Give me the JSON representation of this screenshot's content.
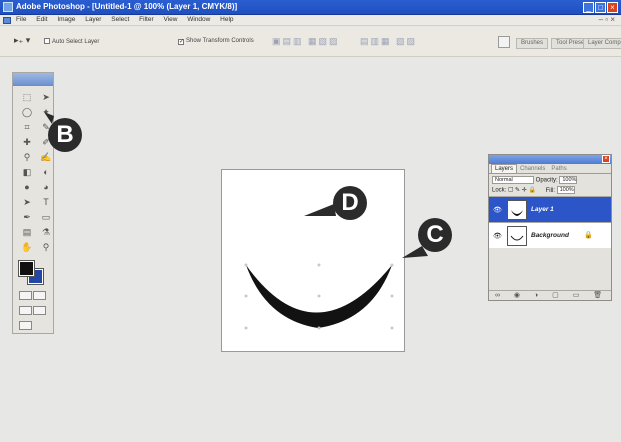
{
  "window": {
    "title": "Adobe Photoshop - [Untitled-1 @ 100% (Layer 1, CMYK/8)]",
    "controls": [
      "_",
      "□",
      "×"
    ]
  },
  "menu": {
    "items": [
      "File",
      "Edit",
      "Image",
      "Layer",
      "Select",
      "Filter",
      "View",
      "Window",
      "Help"
    ]
  },
  "options_bar": {
    "auto_select_layer": "Auto Select Layer",
    "show_transform_controls": "Show Transform Controls",
    "palette_tabs": [
      "Brushes",
      "Tool Presets",
      "Layer Comps"
    ]
  },
  "callouts": {
    "b": "B",
    "c": "C",
    "d": "D"
  },
  "layers_panel": {
    "tabs": [
      "Layers",
      "Channels",
      "Paths"
    ],
    "blend_mode": "Normal",
    "opacity_label": "Opacity:",
    "opacity_value": "100%",
    "lock_label": "Lock:",
    "fill_label": "Fill:",
    "fill_value": "100%",
    "layers": [
      {
        "name": "Layer 1",
        "selected": true
      },
      {
        "name": "Background",
        "selected": false
      }
    ]
  },
  "colors": {
    "foreground": "#111111",
    "background": "#2247a6",
    "selection": "#2c55c8",
    "titlebar": "#2a5fd1"
  }
}
